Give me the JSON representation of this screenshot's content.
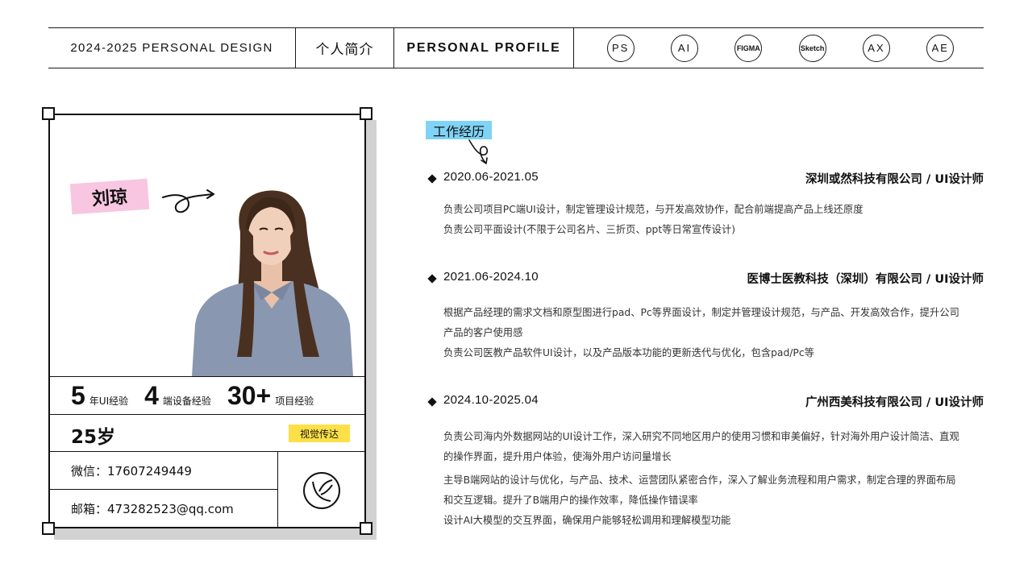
{
  "header": {
    "design_title": "2024-2025 PERSONAL DESIGN",
    "section_cn": "个人简介",
    "section_en": "PERSONAL PROFILE",
    "tools": [
      "PS",
      "AI",
      "FIGMA",
      "Sketch",
      "AX",
      "AE"
    ]
  },
  "profile": {
    "name": "刘琼",
    "stats": [
      {
        "number": "5",
        "label": "年UI经验"
      },
      {
        "number": "4",
        "label": "端设备经验"
      },
      {
        "number": "30+",
        "label": "项目经验"
      }
    ],
    "age": "25岁",
    "badge": "视觉传达",
    "wechat": "微信：17607249449",
    "email": "邮箱：473282523@qq.com"
  },
  "work": {
    "section_label": "工作经历",
    "jobs": [
      {
        "date": "2020.06-2021.05",
        "company": "深圳或然科技有限公司 / UI设计师",
        "lines": [
          "负责公司项目PC端UI设计，制定管理设计规范，与开发高效协作，配合前端提高产品上线还原度",
          "负责公司平面设计(不限于公司名片、三折页、ppt等日常宣传设计)"
        ]
      },
      {
        "date": "2021.06-2024.10",
        "company": "医博士医教科技（深圳）有限公司 / UI设计师",
        "lines": [
          "根据产品经理的需求文档和原型图进行pad、Pc等界面设计，制定并管理设计规范，与产品、开发高效合作，提升公司",
          "产品的客户使用感",
          "负责公司医教产品软件UI设计，以及产品版本功能的更新迭代与优化，包含pad/Pc等"
        ]
      },
      {
        "date": "2024.10-2025.04",
        "company": "广州西美科技有限公司 / UI设计师",
        "lines": [
          "负责公司海内外数据网站的UI设计工作，深入研究不同地区用户的使用习惯和审美偏好，针对海外用户设计简洁、直观",
          "的操作界面，提升用户体验，使海外用户访问量增长",
          "主导B端网站的设计与优化，与产品、技术、运营团队紧密合作，深入了解业务流程和用户需求，制定合理的界面布局",
          "和交互逻辑。提升了B端用户的操作效率，降低操作错误率",
          "设计AI大模型的交互界面，确保用户能够轻松调用和理解模型功能"
        ]
      }
    ]
  }
}
